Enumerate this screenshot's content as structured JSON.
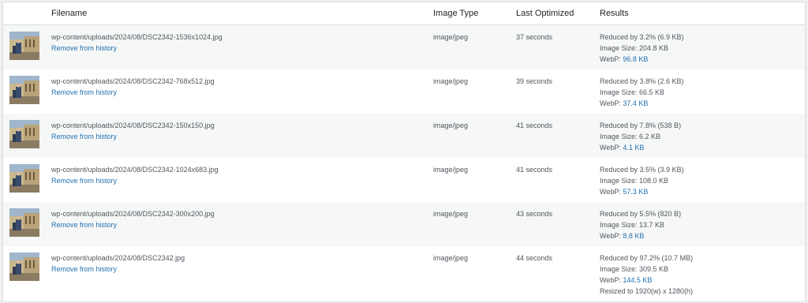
{
  "header": {
    "filename": "Filename",
    "image_type": "Image Type",
    "last_optimized": "Last Optimized",
    "results": "Results"
  },
  "colors": {
    "link": "#2271b1",
    "alt_row": "#f6f7f7",
    "border": "#dcdcde"
  },
  "rows": [
    {
      "filename": "wp-content/uploads/2024/08/DSC2342-1536x1024.jpg",
      "remove": "Remove from history",
      "type": "image/jpeg",
      "optimized": "37 seconds",
      "reduced": "Reduced by 3.2% (6.9 KB)",
      "size": "Image Size: 204.8 KB",
      "webp_label": "WebP: ",
      "webp": "96.8 KB"
    },
    {
      "filename": "wp-content/uploads/2024/08/DSC2342-768x512.jpg",
      "remove": "Remove from history",
      "type": "image/jpeg",
      "optimized": "39 seconds",
      "reduced": "Reduced by 3.8% (2.6 KB)",
      "size": "Image Size: 66.5 KB",
      "webp_label": "WebP: ",
      "webp": "37.4 KB"
    },
    {
      "filename": "wp-content/uploads/2024/08/DSC2342-150x150.jpg",
      "remove": "Remove from history",
      "type": "image/jpeg",
      "optimized": "41 seconds",
      "reduced": "Reduced by 7.8% (538 B)",
      "size": "Image Size: 6.2 KB",
      "webp_label": "WebP: ",
      "webp": "4.1 KB"
    },
    {
      "filename": "wp-content/uploads/2024/08/DSC2342-1024x683.jpg",
      "remove": "Remove from history",
      "type": "image/jpeg",
      "optimized": "41 seconds",
      "reduced": "Reduced by 3.5% (3.9 KB)",
      "size": "Image Size: 108.0 KB",
      "webp_label": "WebP: ",
      "webp": "57.3 KB"
    },
    {
      "filename": "wp-content/uploads/2024/08/DSC2342-300x200.jpg",
      "remove": "Remove from history",
      "type": "image/jpeg",
      "optimized": "43 seconds",
      "reduced": "Reduced by 5.5% (820 B)",
      "size": "Image Size: 13.7 KB",
      "webp_label": "WebP: ",
      "webp": "8.8 KB"
    },
    {
      "filename": "wp-content/uploads/2024/08/DSC2342.jpg",
      "remove": "Remove from history",
      "type": "image/jpeg",
      "optimized": "44 seconds",
      "reduced": "Reduced by 97.2% (10.7 MB)",
      "size": "Image Size: 309.5 KB",
      "webp_label": "WebP: ",
      "webp": "144.5 KB",
      "resized": "Resized to 1920(w) x 1280(h)"
    }
  ]
}
